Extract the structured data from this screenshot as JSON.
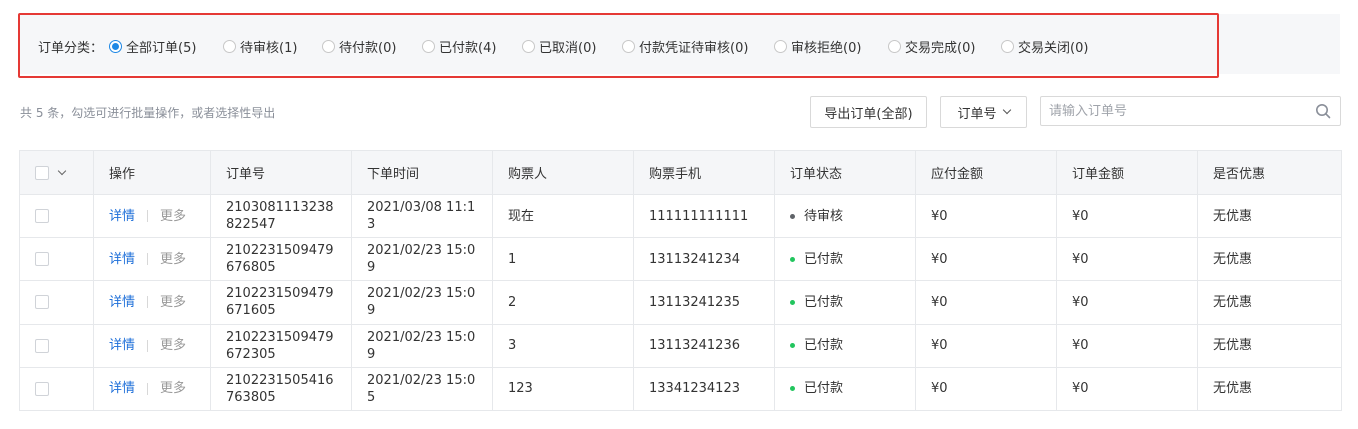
{
  "filter": {
    "label": "订单分类：",
    "options": [
      {
        "label": "全部订单(5)",
        "checked": true
      },
      {
        "label": "待审核(1)",
        "checked": false
      },
      {
        "label": "待付款(0)",
        "checked": false
      },
      {
        "label": "已付款(4)",
        "checked": false
      },
      {
        "label": "已取消(0)",
        "checked": false
      },
      {
        "label": "付款凭证待审核(0)",
        "checked": false
      },
      {
        "label": "审核拒绝(0)",
        "checked": false
      },
      {
        "label": "交易完成(0)",
        "checked": false
      },
      {
        "label": "交易关闭(0)",
        "checked": false
      }
    ]
  },
  "toolbar": {
    "summary": "共 5 条，勾选可进行批量操作，或者选择性导出",
    "export_label": "导出订单(全部)",
    "select_label": "订单号",
    "search_placeholder": "请输入订单号"
  },
  "table": {
    "headers": [
      "操作",
      "订单号",
      "下单时间",
      "购票人",
      "购票手机",
      "订单状态",
      "应付金额",
      "订单金额",
      "是否优惠"
    ],
    "detail_label": "详情",
    "more_label": "更多",
    "status_colors": {
      "待审核": "#5f6368",
      "已付款": "#22c55e"
    },
    "rows": [
      {
        "order_no": "2103081113238822547",
        "time": "2021/03/08 11:13",
        "buyer": "现在",
        "phone": "111111111111",
        "status": "待审核",
        "payable": "¥0",
        "amount": "¥0",
        "discount": "无优惠"
      },
      {
        "order_no": "2102231509479676805",
        "time": "2021/02/23 15:09",
        "buyer": "1",
        "phone": "13113241234",
        "status": "已付款",
        "payable": "¥0",
        "amount": "¥0",
        "discount": "无优惠"
      },
      {
        "order_no": "2102231509479671605",
        "time": "2021/02/23 15:09",
        "buyer": "2",
        "phone": "13113241235",
        "status": "已付款",
        "payable": "¥0",
        "amount": "¥0",
        "discount": "无优惠"
      },
      {
        "order_no": "2102231509479672305",
        "time": "2021/02/23 15:09",
        "buyer": "3",
        "phone": "13113241236",
        "status": "已付款",
        "payable": "¥0",
        "amount": "¥0",
        "discount": "无优惠"
      },
      {
        "order_no": "2102231505416763805",
        "time": "2021/02/23 15:05",
        "buyer": "123",
        "phone": "13341234123",
        "status": "已付款",
        "payable": "¥0",
        "amount": "¥0",
        "discount": "无优惠"
      }
    ]
  }
}
